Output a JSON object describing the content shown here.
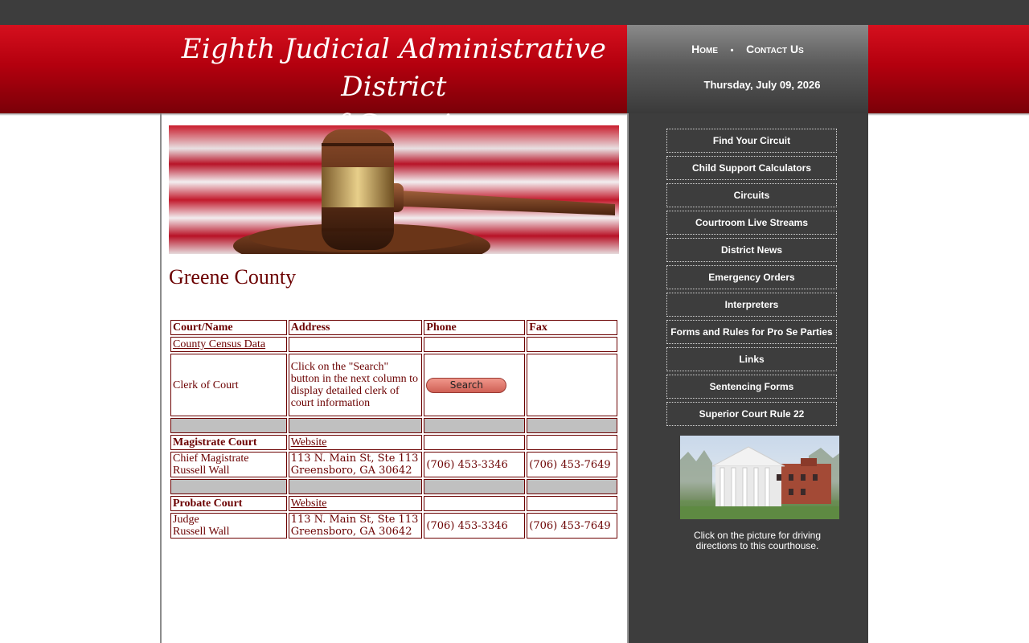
{
  "header": {
    "title_line1": "Eighth Judicial Administrative District",
    "title_line2": "of Georgia",
    "nav": {
      "home": "Home",
      "separator": "•",
      "contact": "Contact Us"
    },
    "date": "Thursday, July 09, 2026"
  },
  "main": {
    "county_title": "Greene County",
    "table": {
      "headers": [
        "Court/Name",
        "Address",
        "Phone",
        "Fax"
      ],
      "census_link": "County Census Data",
      "clerk": {
        "name": "Clerk of Court",
        "address": "Click on the \"Search\" button in the next column to display detailed clerk of court information",
        "search_label": "Search"
      },
      "magistrate": {
        "court": "Magistrate Court",
        "website": "Website",
        "title": "Chief Magistrate",
        "person": "Russell Wall",
        "address_line1": "113 N. Main St, Ste 113",
        "address_line2": "Greensboro, GA 30642",
        "phone": "(706) 453-3346",
        "fax": "(706) 453-7649"
      },
      "probate": {
        "court": "Probate Court",
        "website": "Website",
        "title": "Judge",
        "person": "Russell Wall",
        "address_line1": "113 N. Main St, Ste 113",
        "address_line2": "Greensboro, GA 30642",
        "phone": "(706) 453-3346",
        "fax": "(706) 453-7649"
      }
    }
  },
  "sidebar": {
    "menu": [
      "Find Your Circuit",
      "Child Support Calculators",
      "Circuits",
      "Courtroom Live Streams",
      "District News",
      "Emergency Orders",
      "Interpreters",
      "Forms and Rules for Pro Se Parties",
      "Links",
      "Sentencing Forms",
      "Superior Court Rule 22"
    ],
    "caption": "Click on the picture for driving directions to this courthouse."
  },
  "colors": {
    "header_red": "#b4000e",
    "sidebar_gray": "#3d3d3d",
    "text_maroon": "#6b0000",
    "search_button": "#e07a6e"
  }
}
